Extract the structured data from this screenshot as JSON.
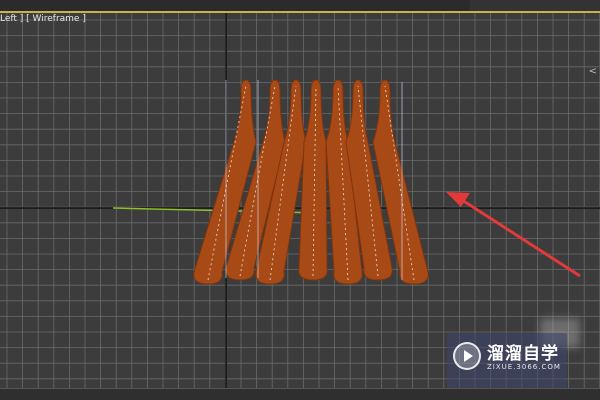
{
  "app": {
    "topbar_title": "",
    "viewport_label": "Left ] [ Wireframe ]",
    "corner_marker": "<"
  },
  "viewport": {
    "name": "Left",
    "mode": "Wireframe",
    "background_color": "#3c3c3c",
    "grid_color": "#6a6a6a",
    "axis_color": "#111111",
    "object_color": "#a84a16",
    "arrow_color": "#e23a3a",
    "active_border_color": "#c9b24a",
    "object_count": 8
  },
  "watermark": {
    "title": "溜溜自学",
    "url": "ZIXUE.3066.COM"
  }
}
